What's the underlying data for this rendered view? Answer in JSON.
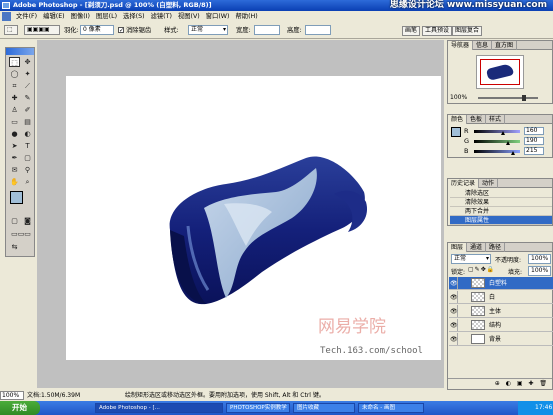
{
  "window": {
    "title": "Adobe Photoshop - [剃须刀.psd @ 100% (白塑料, RGB/8)]",
    "watermark": "思缘设计论坛 www.missyuan.com"
  },
  "menu": [
    "文件(F)",
    "编辑(E)",
    "图像(I)",
    "图层(L)",
    "选择(S)",
    "滤镜(T)",
    "视图(V)",
    "窗口(W)",
    "帮助(H)"
  ],
  "options": {
    "feather_label": "羽化:",
    "feather_value": "0 像素",
    "antialias_label": "消除锯齿",
    "style_label": "样式:",
    "style_value": "正常",
    "width_label": "宽度:",
    "height_label": "高度:",
    "palette_tabs": [
      "画笔",
      "工具预设",
      "图层复合"
    ]
  },
  "navigator": {
    "tabs": [
      "导航器",
      "信息",
      "直方图"
    ],
    "zoom": "100%"
  },
  "color": {
    "tabs": [
      "颜色",
      "色板",
      "样式"
    ],
    "channels": [
      {
        "label": "R",
        "value": "160",
        "fraction": 0.627,
        "color": "#a0a0ff"
      },
      {
        "label": "G",
        "value": "190",
        "fraction": 0.745,
        "color": "#7fd07f"
      },
      {
        "label": "B",
        "value": "215",
        "fraction": 0.843,
        "color": "#8aa0ff"
      }
    ],
    "foreground": "#a0bed7"
  },
  "history": {
    "tabs": [
      "历史记录",
      "动作"
    ],
    "items": [
      "清除选区",
      "清除效果",
      "两下合并",
      "图层属性"
    ],
    "selected_index": 3
  },
  "layers": {
    "tabs": [
      "图层",
      "通道",
      "路径"
    ],
    "blend_mode": "正常",
    "opacity_label": "不透明度:",
    "opacity_value": "100%",
    "lock_label": "锁定:",
    "fill_label": "填充:",
    "fill_value": "100%",
    "items": [
      {
        "name": "白塑料",
        "selected": true
      },
      {
        "name": "白",
        "selected": false
      },
      {
        "name": "主体",
        "selected": false
      },
      {
        "name": "结构",
        "selected": false
      },
      {
        "name": "背景",
        "selected": false
      }
    ]
  },
  "canvas": {
    "logo_text": "网易学院",
    "logo_url": "Tech.163.com/school",
    "body_color": "#1a2a7a",
    "accent_color": "#a8c0dc"
  },
  "status": {
    "zoom": "100%",
    "doc": "文档:1.50M/6.39M",
    "message": "绘制矩形选区或移动选区外框。要用附加选项，使用 Shift, Alt 和 Ctrl 键。"
  },
  "taskbar": {
    "start": "开始",
    "tasks": [
      "Adobe Photoshop - [...",
      "PHOTOSHOP实例教学",
      "图片收藏",
      "未命名 - 画图"
    ],
    "clock": "17:46"
  }
}
